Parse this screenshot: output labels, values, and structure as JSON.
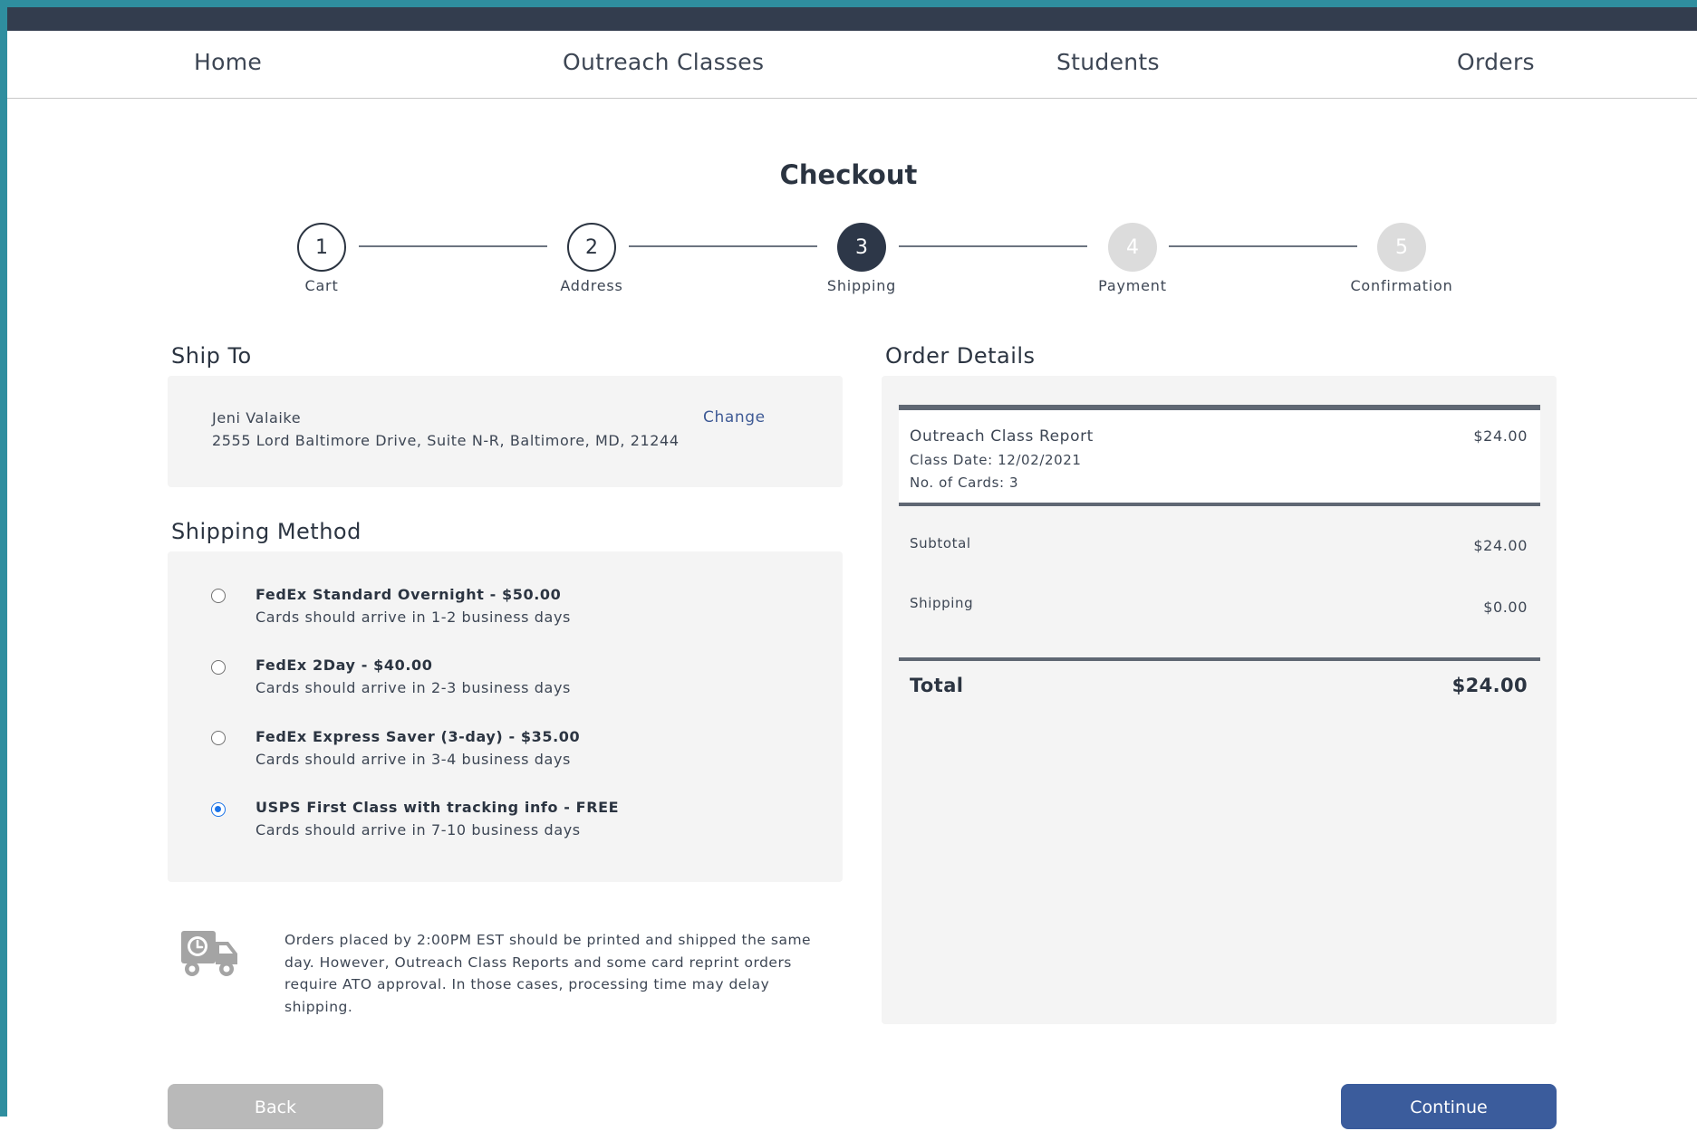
{
  "nav": {
    "items": [
      {
        "label": "Home"
      },
      {
        "label": "Outreach Classes"
      },
      {
        "label": "Students"
      },
      {
        "label": "Orders"
      }
    ]
  },
  "page": {
    "title": "Checkout"
  },
  "steps": [
    {
      "number": "1",
      "label": "Cart",
      "state": "done"
    },
    {
      "number": "2",
      "label": "Address",
      "state": "done"
    },
    {
      "number": "3",
      "label": "Shipping",
      "state": "current"
    },
    {
      "number": "4",
      "label": "Payment",
      "state": "future"
    },
    {
      "number": "5",
      "label": "Confirmation",
      "state": "future"
    }
  ],
  "ship_to": {
    "heading": "Ship To",
    "name": "Jeni Valaike",
    "address": "2555 Lord Baltimore Drive, Suite N-R, Baltimore, MD, 21244",
    "change_label": "Change"
  },
  "shipping_method": {
    "heading": "Shipping Method",
    "options": [
      {
        "title": "FedEx Standard Overnight - $50.00",
        "subtitle": "Cards should arrive in 1-2 business days",
        "selected": false
      },
      {
        "title": "FedEx 2Day - $40.00",
        "subtitle": "Cards should arrive in 2-3 business days",
        "selected": false
      },
      {
        "title": "FedEx Express Saver (3-day) - $35.00",
        "subtitle": "Cards should arrive in 3-4 business days",
        "selected": false
      },
      {
        "title": "USPS First Class with tracking info - FREE",
        "subtitle": "Cards should arrive in 7-10 business days",
        "selected": true
      }
    ],
    "note": "Orders placed by 2:00PM EST should be printed and shipped the same day. However, Outreach Class Reports and some card reprint orders require ATO approval. In those cases, processing time may delay shipping.",
    "note_icon": "delivery-truck-clock-icon"
  },
  "order_details": {
    "heading": "Order Details",
    "item": {
      "name": "Outreach Class Report",
      "price": "$24.00",
      "class_date": "Class Date: 12/02/2021",
      "cards": "No. of Cards: 3"
    },
    "subtotal_label": "Subtotal",
    "subtotal_value": "$24.00",
    "shipping_label": "Shipping",
    "shipping_value": "$0.00",
    "total_label": "Total",
    "total_value": "$24.00"
  },
  "buttons": {
    "back": "Back",
    "continue": "Continue"
  },
  "colors": {
    "topbar": "#333d4e",
    "accent_blue": "#3b5c9c",
    "step_current": "#2d3748",
    "step_future": "#dcdcdc",
    "panel_bg": "#f4f4f4",
    "radio_selected": "#1a73e8"
  }
}
